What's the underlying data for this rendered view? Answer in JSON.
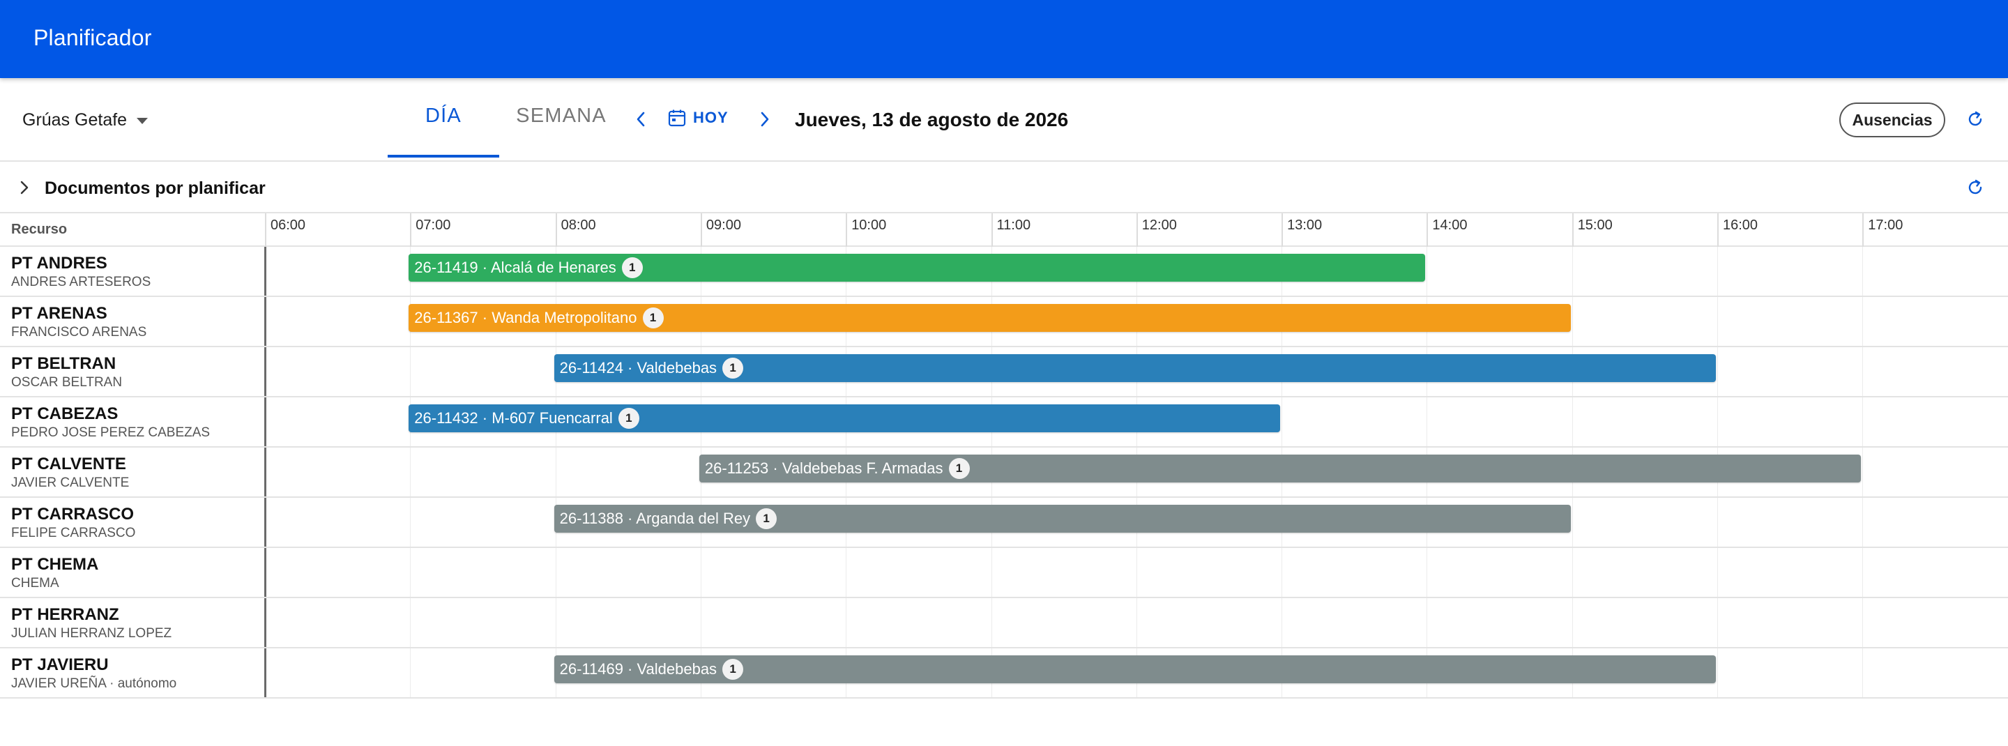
{
  "app": {
    "title": "Planificador"
  },
  "toolbar": {
    "resource_group": "Grúas Getafe",
    "tabs": {
      "day": "DÍA",
      "week": "SEMANA"
    },
    "today_label": "HOY",
    "current_date": "Jueves, 13 de agosto de 2026",
    "absences_label": "Ausencias",
    "icons": {
      "prev": "chevron-left-icon",
      "next": "chevron-right-icon",
      "calendar": "calendar-icon",
      "refresh": "refresh-icon",
      "group_select": "caret-down-icon"
    }
  },
  "documents": {
    "title": "Documentos por planificar",
    "icon": "chevron-right-icon"
  },
  "scheduler": {
    "resource_header": "Recurso",
    "hours": [
      "06:00",
      "07:00",
      "08:00",
      "09:00",
      "10:00",
      "11:00",
      "12:00",
      "13:00",
      "14:00",
      "15:00",
      "16:00",
      "17:00"
    ],
    "colors": {
      "green": "#2ead5f",
      "orange": "#f39c19",
      "blue": "#2a80b9",
      "gray": "#7f8c8d"
    },
    "rows": [
      {
        "name": "PT ANDRES",
        "subtitle": "ANDRES ARTESEROS",
        "job": {
          "label": "26-11419 · Alcalá de Henares",
          "count": "1",
          "start": "07:00",
          "end": "14:00",
          "color": "#2ead5f"
        }
      },
      {
        "name": "PT ARENAS",
        "subtitle": "FRANCISCO ARENAS",
        "job": {
          "label": "26-11367 · Wanda Metropolitano",
          "count": "1",
          "start": "07:00",
          "end": "15:00",
          "color": "#f39c19"
        }
      },
      {
        "name": "PT BELTRAN",
        "subtitle": "OSCAR BELTRAN",
        "job": {
          "label": "26-11424 · Valdebebas",
          "count": "1",
          "start": "08:00",
          "end": "16:00",
          "color": "#2a80b9"
        }
      },
      {
        "name": "PT CABEZAS",
        "subtitle": "PEDRO JOSE PEREZ CABEZAS",
        "job": {
          "label": "26-11432 · M-607 Fuencarral",
          "count": "1",
          "start": "07:00",
          "end": "13:00",
          "color": "#2a80b9"
        }
      },
      {
        "name": "PT CALVENTE",
        "subtitle": "JAVIER CALVENTE",
        "job": {
          "label": "26-11253 · Valdebebas F. Armadas",
          "count": "1",
          "start": "09:00",
          "end": "17:00",
          "color": "#7f8c8d"
        }
      },
      {
        "name": "PT CARRASCO",
        "subtitle": "FELIPE CARRASCO",
        "job": {
          "label": "26-11388 · Arganda del Rey",
          "count": "1",
          "start": "08:00",
          "end": "15:00",
          "color": "#7f8c8d"
        }
      },
      {
        "name": "PT CHEMA",
        "subtitle": "CHEMA",
        "job": null
      },
      {
        "name": "PT HERRANZ",
        "subtitle": "JULIAN HERRANZ LOPEZ",
        "job": null
      },
      {
        "name": "PT JAVIERU",
        "subtitle": "JAVIER UREÑA · autónomo",
        "job": {
          "label": "26-11469 · Valdebebas",
          "count": "1",
          "start": "08:00",
          "end": "16:00",
          "color": "#7f8c8d"
        }
      }
    ]
  }
}
